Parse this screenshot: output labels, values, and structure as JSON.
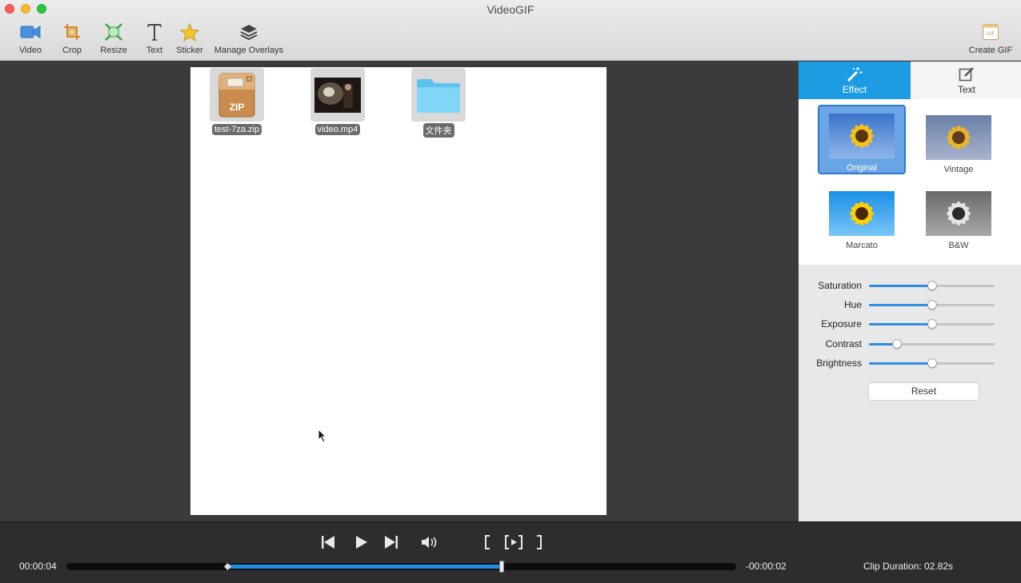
{
  "window": {
    "title": "VideoGIF"
  },
  "toolbar": {
    "video": "Video",
    "crop": "Crop",
    "resize": "Resize",
    "text": "Text",
    "sticker": "Sticker",
    "overlays": "Manage Overlays",
    "create_gif": "Create GIF",
    "create_gif_icon_text": "GIF"
  },
  "canvas": {
    "files": [
      {
        "name": "test-7za.zip",
        "icon": "zip-archive-icon",
        "badge": "ZIP"
      },
      {
        "name": "video.mp4",
        "icon": "video-file-icon"
      },
      {
        "name": "文件夹",
        "icon": "folder-icon"
      }
    ]
  },
  "panel": {
    "tabs": [
      {
        "label": "Effect",
        "active": true
      },
      {
        "label": "Text",
        "active": false
      }
    ],
    "effects": [
      {
        "label": "Original",
        "selected": true
      },
      {
        "label": "Vintage",
        "selected": false
      },
      {
        "label": "Marcato",
        "selected": false
      },
      {
        "label": "B&W",
        "selected": false
      }
    ],
    "sliders": [
      {
        "label": "Saturation",
        "value": 0.5
      },
      {
        "label": "Hue",
        "value": 0.5
      },
      {
        "label": "Exposure",
        "value": 0.5
      },
      {
        "label": "Contrast",
        "value": 0.22
      },
      {
        "label": "Brightness",
        "value": 0.5
      }
    ],
    "reset": "Reset"
  },
  "playback": {
    "current_time": "00:00:04",
    "remaining_time": "-00:00:02",
    "clip_duration": "Clip Duration: 02.82s",
    "selection_start": 0.24,
    "selection_end": 0.65
  },
  "colors": {
    "accent": "#1d9ce4",
    "slider_fill": "#2f8de4",
    "selection": "#1f8fe0"
  }
}
